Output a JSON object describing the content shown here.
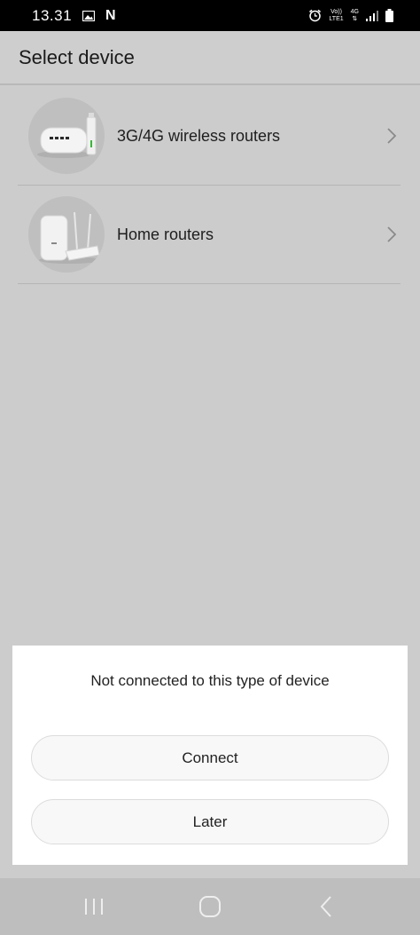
{
  "status_bar": {
    "time": "13.31",
    "notification_letter": "N",
    "volte_top": "Vo))",
    "volte_bottom": "LTE1",
    "network_type": "4G"
  },
  "header": {
    "title": "Select device"
  },
  "device_list": [
    {
      "label": "3G/4G wireless routers"
    },
    {
      "label": "Home routers"
    }
  ],
  "dialog": {
    "message": "Not connected to this type of device",
    "connect_label": "Connect",
    "later_label": "Later"
  }
}
